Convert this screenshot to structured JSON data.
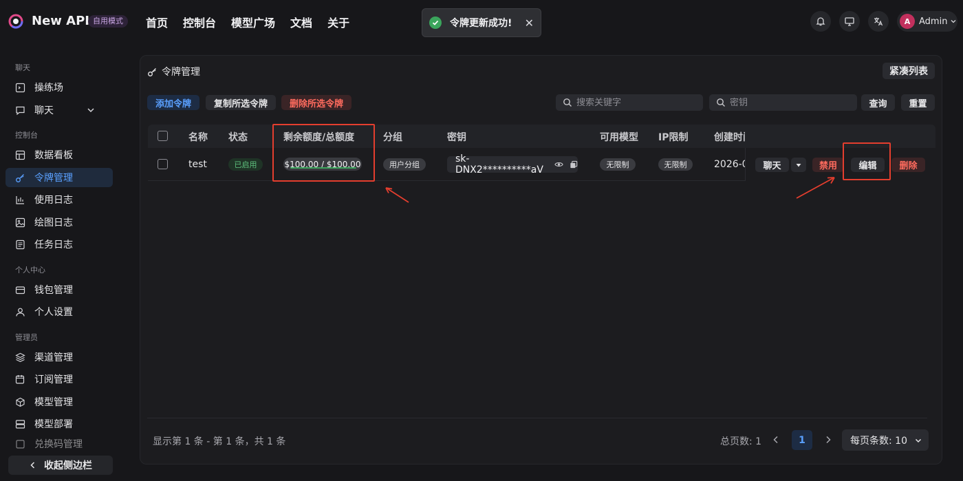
{
  "app": {
    "brand": "New API",
    "mode_tag": "自用模式"
  },
  "nav": [
    "首页",
    "控制台",
    "模型广场",
    "文档",
    "关于"
  ],
  "toast": {
    "message": "令牌更新成功!"
  },
  "user": {
    "avatar_letter": "A",
    "name": "Admin"
  },
  "sidebar": {
    "sections": [
      "聊天",
      "控制台",
      "个人中心",
      "管理员"
    ],
    "items": [
      "操练场",
      "聊天",
      "数据看板",
      "令牌管理",
      "使用日志",
      "绘图日志",
      "任务日志",
      "钱包管理",
      "个人设置",
      "渠道管理",
      "订阅管理",
      "模型管理",
      "模型部署",
      "兑换码管理"
    ],
    "collapse_label": "收起侧边栏"
  },
  "page": {
    "title": "令牌管理",
    "compact_label": "紧凑列表",
    "toolbar": {
      "add": "添加令牌",
      "copy": "复制所选令牌",
      "delete": "删除所选令牌"
    },
    "search_keyword_placeholder": "搜索关键字",
    "search_key_placeholder": "密钥",
    "query_label": "查询",
    "reset_label": "重置"
  },
  "table": {
    "columns": [
      "名称",
      "状态",
      "剩余额度/总额度",
      "分组",
      "密钥",
      "可用模型",
      "IP限制",
      "创建时间"
    ],
    "rows": [
      {
        "name": "test",
        "status": "已启用",
        "quota": "$100.00 / $100.00",
        "quota_remaining_fraction": 1.0,
        "group": "用户分组",
        "key": "sk-DNX2**********aV",
        "models": "无限制",
        "ip_limit": "无限制",
        "created": "2026-0",
        "actions": {
          "chat": "聊天",
          "disable": "禁用",
          "edit": "编辑",
          "delete": "删除"
        }
      }
    ]
  },
  "footer": {
    "summary": "显示第 1 条 - 第 1 条，共 1 条",
    "total_pages": "总页数: 1",
    "current_page": "1",
    "page_size": "每页条数: 10"
  },
  "colors": {
    "accent": "#5aa0ff",
    "danger": "#ff6b5e",
    "success": "#3ba55c",
    "highlight": "#e53e2e"
  }
}
